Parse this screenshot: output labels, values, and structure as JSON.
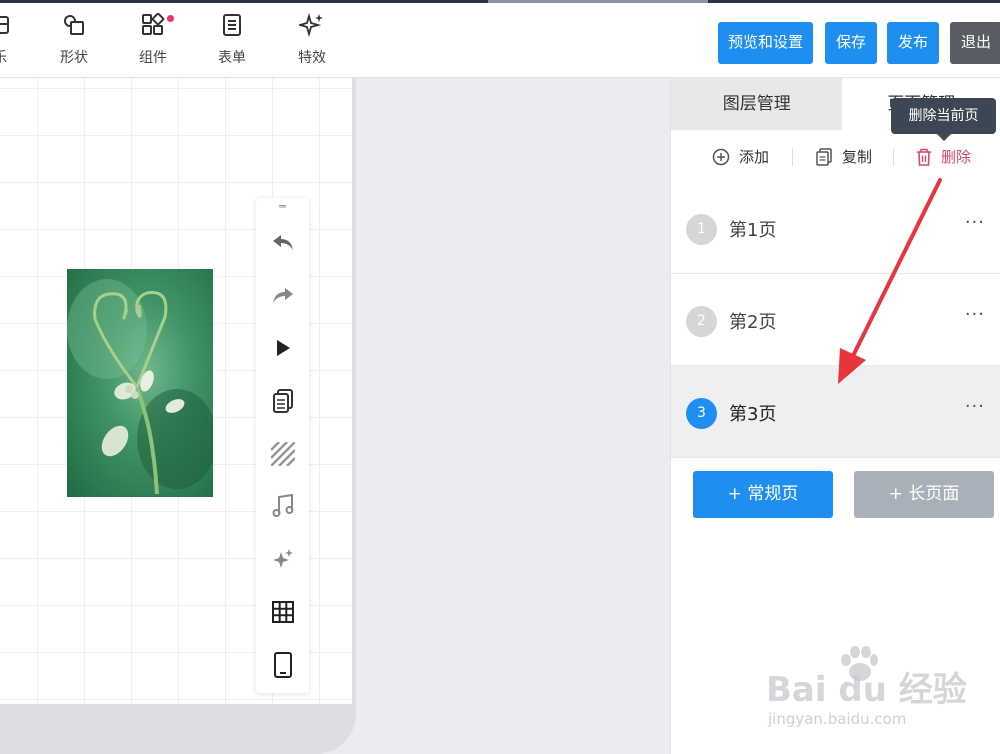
{
  "toolbar": {
    "items": [
      {
        "label": "乐",
        "icon": "music-icon"
      },
      {
        "label": "形状",
        "icon": "shape-icon"
      },
      {
        "label": "组件",
        "icon": "widget-icon"
      },
      {
        "label": "表单",
        "icon": "form-icon"
      },
      {
        "label": "特效",
        "icon": "sparkle-icon"
      }
    ],
    "preview_label": "预览和设置",
    "save_label": "保存",
    "publish_label": "发布",
    "exit_label": "退出"
  },
  "canvas": {
    "image_alt": "heart-shaped vine plant photo",
    "side_tools": [
      "undo-icon",
      "redo-icon",
      "play-icon",
      "copy-icon",
      "pattern-icon",
      "music-icon",
      "sparkle-icon",
      "grid-icon",
      "phone-icon"
    ]
  },
  "panel": {
    "tabs": [
      "图层管理",
      "页面管理"
    ],
    "actions": {
      "add": "添加",
      "copy": "复制",
      "delete": "删除"
    },
    "tooltip": "删除当前页",
    "pages": [
      {
        "num": "1",
        "name": "第1页",
        "more": "···",
        "active": false
      },
      {
        "num": "2",
        "name": "第2页",
        "more": "···",
        "active": false
      },
      {
        "num": "3",
        "name": "第3页",
        "more": "···",
        "active": true
      }
    ],
    "add_normal": "+ 常规页",
    "add_long": "+ 长页面"
  },
  "watermark": {
    "brand": "Bai du 经验",
    "url": "jingyan.baidu.com"
  },
  "colors": {
    "accent": "#1f8ef1",
    "danger": "#d9486f",
    "arrow": "#e8343a"
  }
}
